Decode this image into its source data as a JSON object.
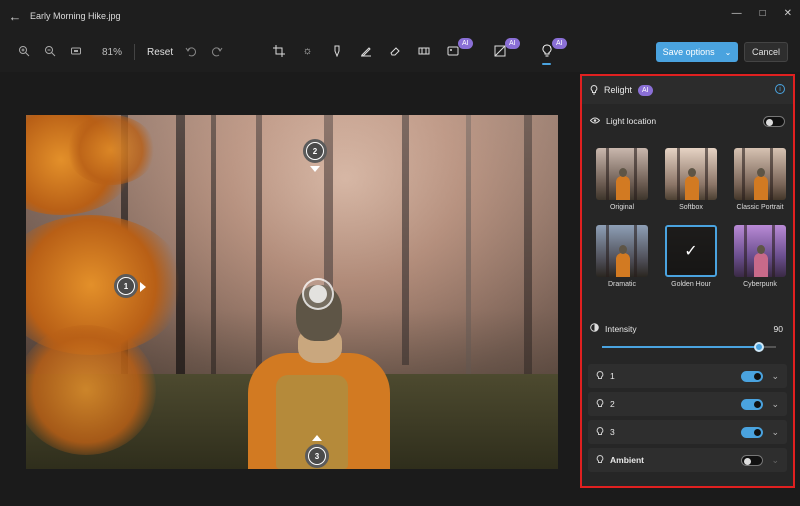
{
  "window": {
    "title": "Early Morning Hike.jpg"
  },
  "toolbar": {
    "zoom": "81%",
    "reset_label": "Reset",
    "ai_badge": "AI",
    "save_label": "Save options",
    "cancel_label": "Cancel"
  },
  "photo": {
    "markers": [
      "1",
      "2",
      "3"
    ]
  },
  "panel": {
    "title": "Relight",
    "ai_badge": "AI",
    "light_location_label": "Light location",
    "light_location_on": false,
    "presets": [
      {
        "label": "Original",
        "selected": false
      },
      {
        "label": "Softbox",
        "selected": false
      },
      {
        "label": "Classic Portrait",
        "selected": false
      },
      {
        "label": "Dramatic",
        "selected": false
      },
      {
        "label": "Golden Hour",
        "selected": true
      },
      {
        "label": "Cyberpunk",
        "selected": false
      }
    ],
    "intensity": {
      "label": "Intensity",
      "value": "90",
      "fraction": 0.9
    },
    "lights": [
      {
        "label": "1",
        "on": true
      },
      {
        "label": "2",
        "on": true
      },
      {
        "label": "3",
        "on": true
      },
      {
        "label": "Ambient",
        "on": false
      }
    ]
  },
  "colors": {
    "accent": "#4aa3df",
    "ai_badge": "#8a6fd6",
    "highlight_border": "#e02020"
  },
  "icons": [
    "back-arrow-icon",
    "minimize-icon",
    "maximize-icon",
    "close-icon",
    "zoom-in-icon",
    "zoom-out-icon",
    "fit-screen-icon",
    "undo-icon",
    "redo-icon",
    "crop-icon",
    "brightness-icon",
    "filter-icon",
    "markup-icon",
    "erase-icon",
    "background-icon",
    "generative-fill-icon",
    "style-icon",
    "relight-bulb-icon",
    "info-icon",
    "eye-icon",
    "intensity-icon",
    "chevron-down-icon"
  ]
}
